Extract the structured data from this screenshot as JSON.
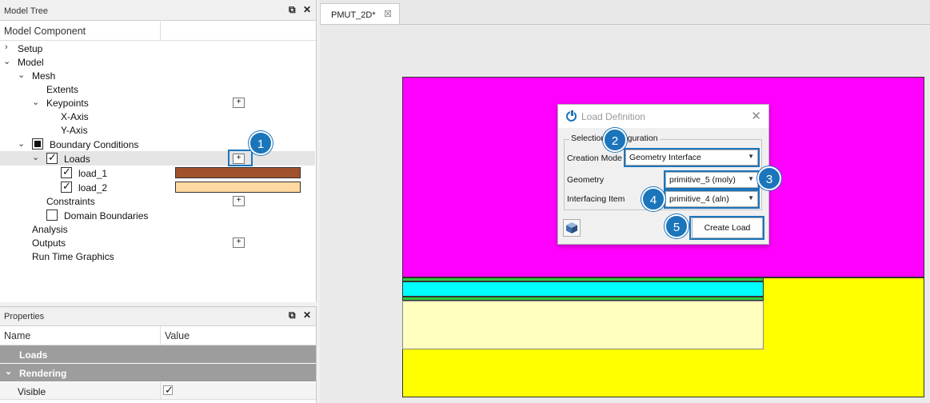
{
  "tree_panel": {
    "title": "Model Tree",
    "float_icon": "⧉",
    "close_icon": "✕",
    "col1": "Model Component",
    "col2": "",
    "items": {
      "setup": "Setup",
      "model": "Model",
      "mesh": "Mesh",
      "extents": "Extents",
      "keypoints": "Keypoints",
      "x_axis": "X-Axis",
      "y_axis": "Y-Axis",
      "boundary_conditions": "Boundary Conditions",
      "loads": "Loads",
      "load_1": "load_1",
      "load_2": "load_2",
      "constraints": "Constraints",
      "domain_boundaries": "Domain Boundaries",
      "analysis": "Analysis",
      "outputs": "Outputs",
      "run_time_graphics": "Run Time Graphics"
    },
    "load_1_color": "#a0522d",
    "load_2_color": "#ffd9a0",
    "plus": "+"
  },
  "props_panel": {
    "title": "Properties",
    "col1": "Name",
    "col2": "Value",
    "group_loads": "Loads",
    "group_rendering": "Rendering",
    "visible_label": "Visible",
    "visible_checked": true
  },
  "viewer": {
    "tab_label": "PMUT_2D*",
    "tab_close": "☒"
  },
  "dialog": {
    "title": "Load Definition",
    "close": "✕",
    "legend": "Selection Configuration",
    "creation_mode_label": "Creation Mode",
    "creation_mode_value": "Geometry Interface",
    "geometry_label": "Geometry",
    "geometry_value": "primitive_5 (moly)",
    "interfacing_label": "Interfacing Item",
    "interfacing_value": "primitive_4 (aln)",
    "create_button": "Create Load"
  },
  "callouts": [
    "1",
    "2",
    "3",
    "4",
    "5"
  ],
  "colors": {
    "accent": "#1b75bb",
    "magenta": "#ff00ff",
    "yellow": "#ffff00",
    "cyan": "#00ffff",
    "green": "#2ecc40",
    "cream": "#ffffc0"
  }
}
